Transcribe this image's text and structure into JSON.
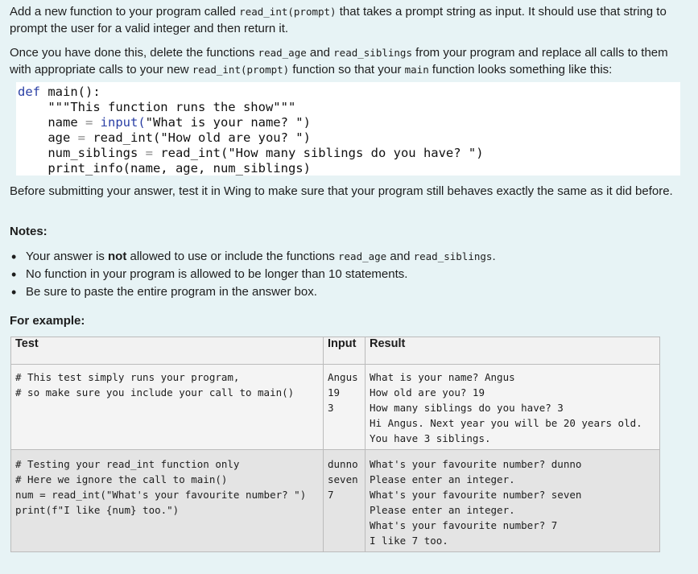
{
  "intro": {
    "p1_a": "Add a new function to your program called ",
    "p1_code": "read_int(prompt)",
    "p1_b": " that takes a prompt string as input. It should use that string to prompt the user for a valid integer and then return it.",
    "p2_a": "Once you have done this, delete the functions ",
    "p2_code1": "read_age",
    "p2_b": " and ",
    "p2_code2": "read_siblings",
    "p2_c": " from your program and replace all calls to them with appropriate calls to your new ",
    "p2_code3": "read_int(prompt)",
    "p2_d": " function so that your ",
    "p2_code4": "main",
    "p2_e": " function looks something like this:"
  },
  "code": {
    "l1_kw": "def",
    "l1_rest": " main():",
    "l2": "    \"\"\"This function runs the show\"\"\"",
    "l3_a": "    name ",
    "l3_op": "=",
    "l3_fn": " input(",
    "l3_str": "\"What is your name? \"",
    "l3_end": ")",
    "l4_a": "    age ",
    "l4_op": "=",
    "l4_b": " read_int(",
    "l4_str": "\"How old are you? \"",
    "l4_end": ")",
    "l5_a": "    num_siblings ",
    "l5_op": "=",
    "l5_b": " read_int(",
    "l5_str": "\"How many siblings do you have? \"",
    "l5_end": ")",
    "l6": "    print_info(name, age, num_siblings)"
  },
  "p3": "Before submitting your answer, test it in Wing to make sure that your program still behaves exactly the same as it did before.",
  "notes": {
    "heading": "Notes:",
    "n1_a": "Your answer is ",
    "n1_bold": "not",
    "n1_b": " allowed to use or include the functions ",
    "n1_code1": "read_age",
    "n1_c": " and ",
    "n1_code2": "read_siblings",
    "n1_d": ".",
    "n2": "No function in your program is allowed to be longer than 10 statements.",
    "n3": "Be sure to paste the entire program in the answer box."
  },
  "example": {
    "heading": "For example:",
    "headers": [
      "Test",
      "Input",
      "Result"
    ],
    "rows": [
      {
        "test": "# This test simply runs your program,\n# so make sure you include your call to main()",
        "input": "Angus\n19\n3",
        "result": "What is your name? Angus\nHow old are you? 19\nHow many siblings do you have? 3\nHi Angus. Next year you will be 20 years old.\nYou have 3 siblings."
      },
      {
        "test": "# Testing your read_int function only\n# Here we ignore the call to main()\nnum = read_int(\"What's your favourite number? \")\nprint(f\"I like {num} too.\")",
        "input": "dunno\nseven\n7",
        "result": "What's your favourite number? dunno\nPlease enter an integer.\nWhat's your favourite number? seven\nPlease enter an integer.\nWhat's your favourite number? 7\nI like 7 too."
      }
    ]
  }
}
